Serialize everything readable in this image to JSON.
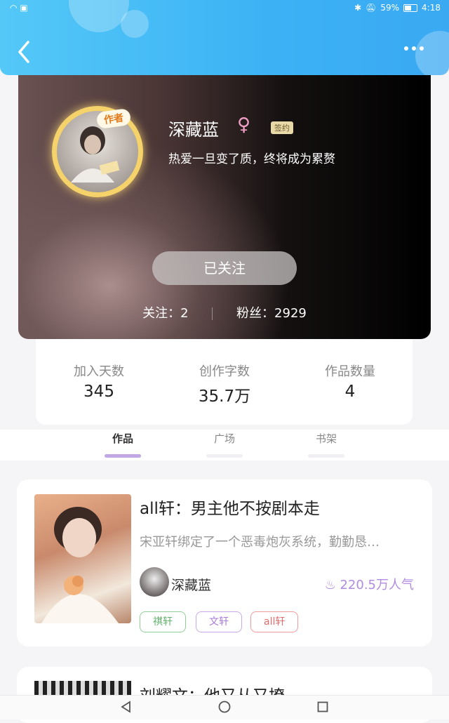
{
  "status_bar": {
    "battery": "59%",
    "time": "4:18"
  },
  "profile": {
    "author_badge": "作者",
    "username": "深藏蓝",
    "gender_icon": "♀",
    "signed_label": "签约",
    "bio": "热爱一旦变了质，终将成为累赘",
    "follow_button": "已关注",
    "following": "关注：2",
    "followers": "粉丝：2929"
  },
  "stats": [
    {
      "label": "加入天数",
      "value": "345"
    },
    {
      "label": "创作字数",
      "value": "35.7万"
    },
    {
      "label": "作品数量",
      "value": "4"
    }
  ],
  "tabs": [
    {
      "label": "作品",
      "active": true
    },
    {
      "label": "广场",
      "active": false
    },
    {
      "label": "书架",
      "active": false
    }
  ],
  "works": [
    {
      "title": "all轩：男主他不按剧本走",
      "description": "宋亚轩绑定了一个恶毒炮灰系统，勤勤恳…",
      "author": "深藏蓝",
      "popularity": "220.5万人气",
      "tags": [
        "祺轩",
        "文轩",
        "all轩"
      ]
    },
    {
      "title": "刘耀文：他又从又撩"
    }
  ],
  "colors": {
    "accent": "#3cb2f5",
    "tab_active": "#c3a6e4",
    "popularity": "#b08be0"
  }
}
